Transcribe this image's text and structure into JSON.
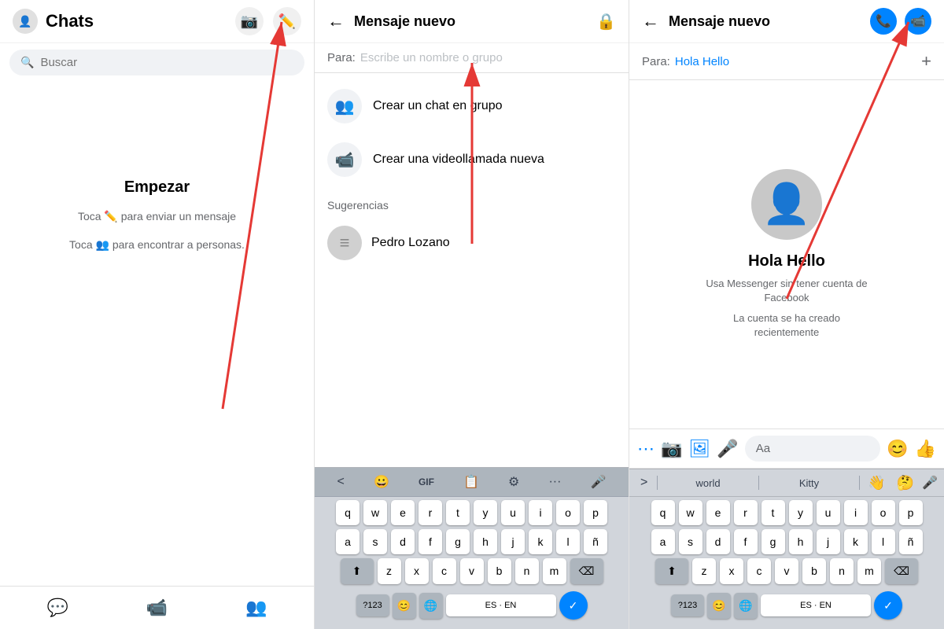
{
  "panel1": {
    "title": "Chats",
    "search_placeholder": "Buscar",
    "empty_title": "Empezar",
    "empty_hint1_prefix": "Toca",
    "empty_hint1_suffix": "para enviar un mensaje",
    "empty_hint2_prefix": "Toca",
    "empty_hint2_suffix": "para encontrar a personas.",
    "nav_items": [
      "chat",
      "video",
      "people"
    ]
  },
  "panel2": {
    "header_title": "Mensaje nuevo",
    "to_label": "Para:",
    "to_placeholder": "Escribe un nombre o grupo",
    "actions": [
      {
        "icon": "👥",
        "label": "Crear un chat en grupo"
      },
      {
        "icon": "📹",
        "label": "Crear una videollamada nueva"
      }
    ],
    "suggestions_label": "Sugerencias",
    "contacts": [
      {
        "name": "Pedro Lozano"
      }
    ],
    "keyboard": {
      "toolbar": [
        "<",
        "😀",
        "GIF",
        "📋",
        "⚙",
        "···",
        "🎤"
      ],
      "rows": [
        [
          "q",
          "w",
          "e",
          "r",
          "t",
          "y",
          "u",
          "i",
          "o",
          "p"
        ],
        [
          "a",
          "s",
          "d",
          "f",
          "g",
          "h",
          "j",
          "k",
          "l",
          "ñ"
        ],
        [
          "⬆",
          "z",
          "x",
          "c",
          "v",
          "b",
          "n",
          "m",
          "⌫"
        ],
        [
          "?123",
          "😊",
          "🌐",
          "ES·EN",
          "✓"
        ]
      ]
    }
  },
  "panel3": {
    "header_title": "Mensaje nuevo",
    "to_label": "Para:",
    "to_value": "Hola Hello",
    "contact_name": "Hola Hello",
    "contact_sub1": "Usa Messenger sin tener cuenta de Facebook",
    "contact_sub2": "La cuenta se ha creado recientemente",
    "keyboard": {
      "suggestions": [
        "world",
        "Kitty",
        "👋",
        "🤔"
      ],
      "rows": [
        [
          "q",
          "w",
          "e",
          "r",
          "t",
          "y",
          "u",
          "i",
          "o",
          "p"
        ],
        [
          "a",
          "s",
          "d",
          "f",
          "g",
          "h",
          "j",
          "k",
          "l",
          "ñ"
        ],
        [
          "⬆",
          "z",
          "x",
          "c",
          "v",
          "b",
          "n",
          "m",
          "⌫"
        ],
        [
          "?123",
          "😊",
          "🌐",
          "ES·EN",
          "✓"
        ]
      ]
    }
  },
  "icons": {
    "camera": "📷",
    "compose": "✏️",
    "search": "🔍",
    "back": "←",
    "phone": "📞",
    "video_call": "📹",
    "plus": "+",
    "dots": "⚙",
    "shield": "🔒",
    "chevron": "›"
  }
}
